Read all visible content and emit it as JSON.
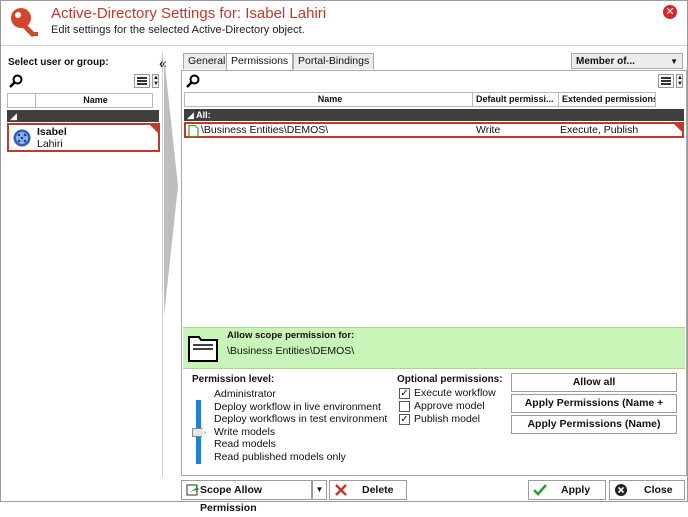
{
  "header": {
    "title": "Active-Directory Settings for: Isabel Lahiri",
    "subtitle": "Edit settings for the selected Active-Directory object.",
    "close_icon": "close-icon"
  },
  "left_panel": {
    "label": "Select user or group:",
    "collapse_glyph": "«",
    "table_header": "Name",
    "selected_item": {
      "first": "Isabel",
      "last": "Lahiri",
      "icon": "user-group-icon"
    }
  },
  "tabs": [
    {
      "label": "General"
    },
    {
      "label": "Permissions",
      "active": true
    },
    {
      "label": "Portal-Bindings"
    }
  ],
  "member_of": {
    "label": "Member of...",
    "caret": "▼"
  },
  "permissions_table": {
    "headers": [
      "Name",
      "Default permissi...",
      "Extended permissions"
    ],
    "group_label": "All:",
    "rows": [
      {
        "name": "\\Business Entities\\DEMOS\\",
        "default": "Write",
        "extended": "Execute, Publish"
      }
    ]
  },
  "scope": {
    "title": "Allow scope permission for:",
    "path": "\\Business Entities\\DEMOS\\"
  },
  "permission_level": {
    "label": "Permission level:",
    "levels": [
      "Administrator",
      "Deploy workflow in live environment",
      "Deploy workflows in test environment",
      "Write models",
      "Read models",
      "Read published models only"
    ],
    "selected": "Write models"
  },
  "optional_permissions": {
    "label": "Optional permissions:",
    "items": [
      {
        "label": "Execute workflow",
        "checked": true
      },
      {
        "label": "Approve model",
        "checked": false
      },
      {
        "label": "Publish model",
        "checked": true
      }
    ]
  },
  "action_buttons": {
    "allow_all": "Allow all",
    "apply_name_level": "Apply Permissions (Name + Level)",
    "apply_name": "Apply Permissions (Name)"
  },
  "bottom_bar": {
    "scope_allow": "Scope Allow Permission",
    "delete": "Delete",
    "apply": "Apply",
    "close": "Close"
  },
  "colors": {
    "accent": "#c0392b",
    "scope_bg": "#c8f4b7",
    "slider": "#1f7fd0"
  }
}
